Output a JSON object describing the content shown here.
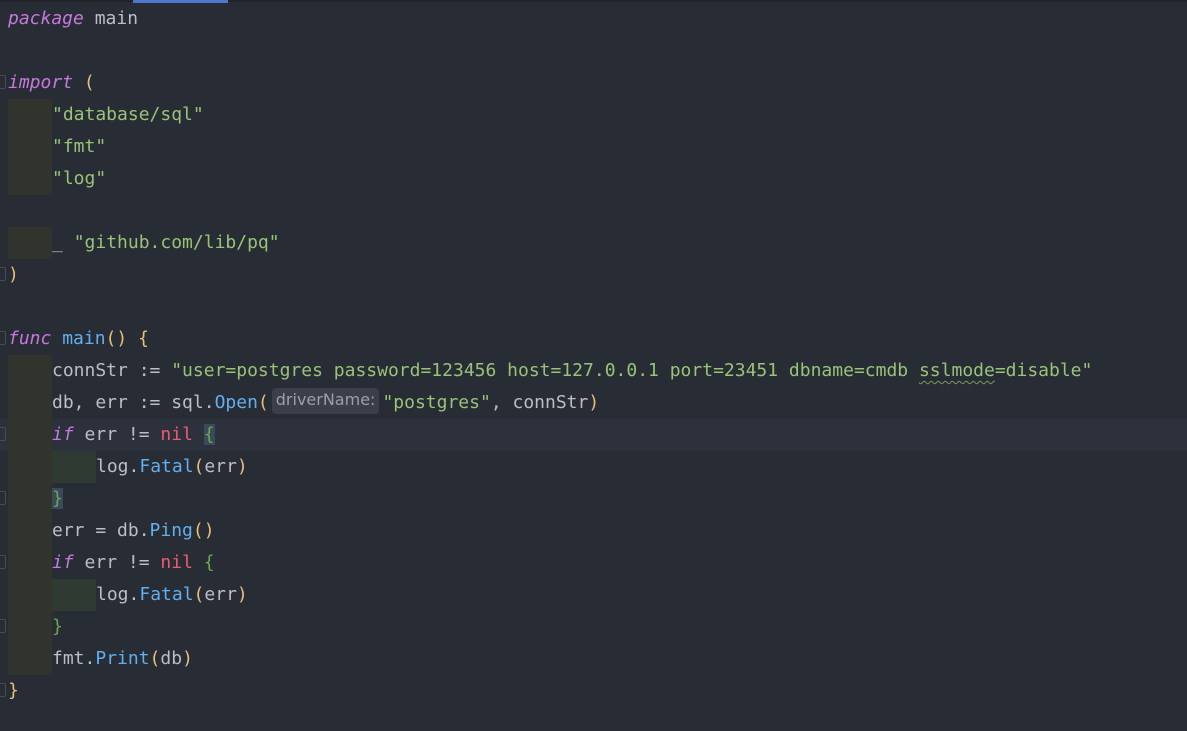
{
  "code": {
    "l1_kw": "package",
    "l1_name": " main",
    "l3_kw": "import",
    "l3_paren": " (",
    "l4_str": "\"database/sql\"",
    "l5_str": "\"fmt\"",
    "l6_str": "\"log\"",
    "l8_blank": "_ ",
    "l8_str": "\"github.com/lib/pq\"",
    "l9_paren": ")",
    "l11_kw": "func",
    "l11_fn": " main",
    "l11_parens": "()",
    "l11_brace": " {",
    "l12_var": "connStr := ",
    "l12_str_a": "\"user=postgres password=123456 host=127.0.0.1 port=23451 dbname=cmdb ",
    "l12_str_squiggle": "sslmode",
    "l12_str_b": "=disable\"",
    "l13_pre": "db, err := sql.",
    "l13_fn": "Open",
    "l13_open": "(",
    "l13_hint": "driverName:",
    "l13_str": "\"postgres\"",
    "l13_rest": ", connStr",
    "l13_close": ")",
    "l14_kw": "if",
    "l14_mid": " err != ",
    "l14_nil": "nil",
    "l14_brace": "{",
    "l15_pre": "log.",
    "l15_fn": "Fatal",
    "l15_open": "(",
    "l15_arg": "err",
    "l15_close": ")",
    "l16_brace": "}",
    "l17_pre": "err = db.",
    "l17_fn": "Ping",
    "l17_parens": "()",
    "l18_kw": "if",
    "l18_mid": " err != ",
    "l18_nil": "nil",
    "l18_brace": " {",
    "l19_pre": "log.",
    "l19_fn": "Fatal",
    "l19_open": "(",
    "l19_arg": "err",
    "l19_close": ")",
    "l20_brace": "}",
    "l21_pre": "fmt.",
    "l21_fn": "Print",
    "l21_open": "(",
    "l21_arg": "db",
    "l21_close": ")",
    "l22_brace": "}"
  },
  "colors": {
    "background": "#282c34",
    "keyword": "#c678dd",
    "string": "#98c379",
    "function": "#61afef",
    "nil": "#ef596f",
    "paren": "#e5c07b"
  }
}
